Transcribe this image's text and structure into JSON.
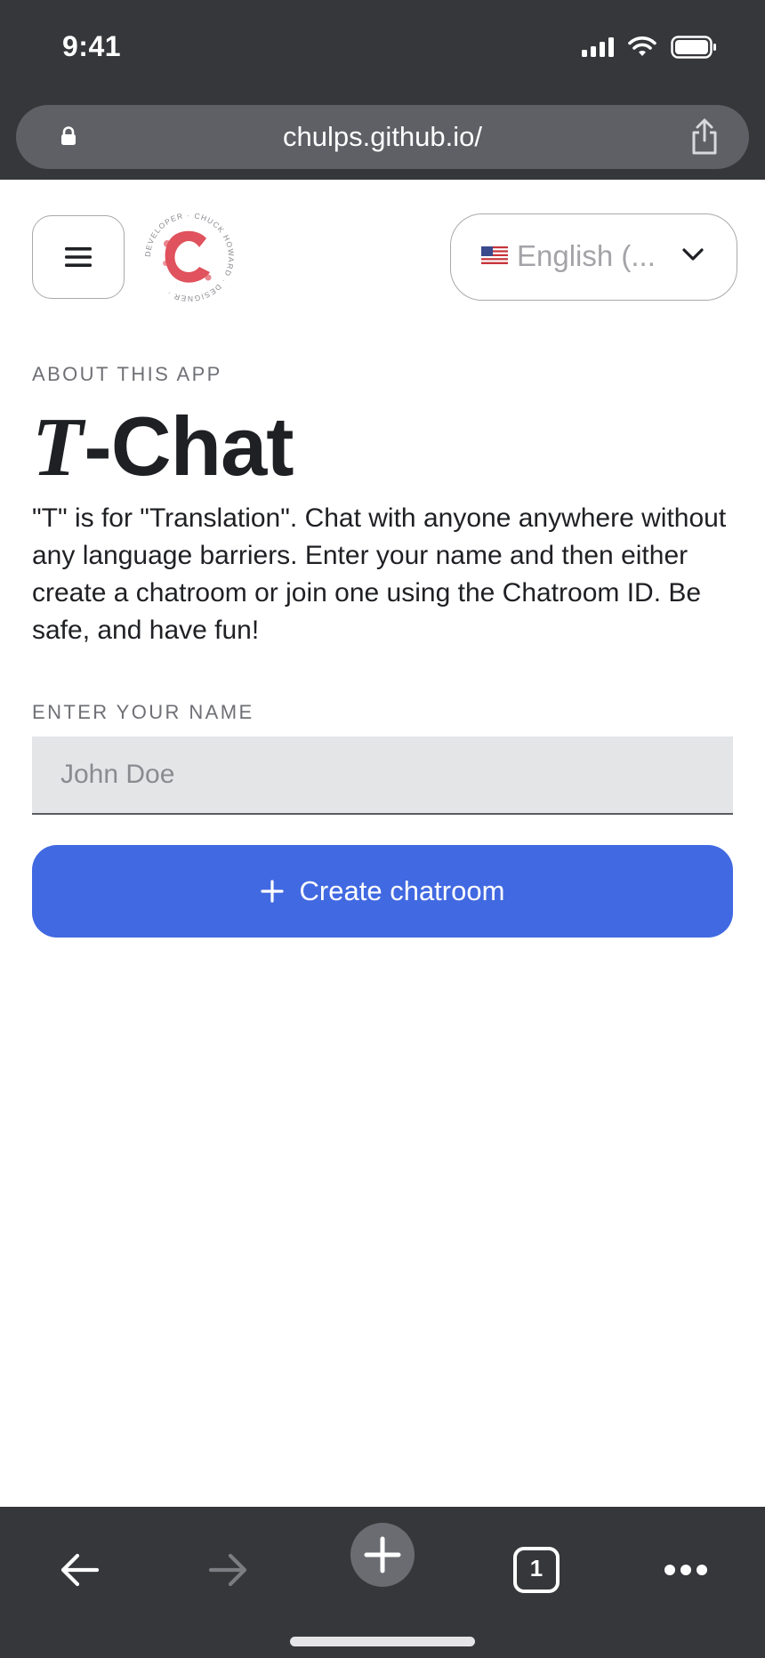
{
  "status_bar": {
    "time": "9:41"
  },
  "browser": {
    "url": "chulps.github.io/"
  },
  "header": {
    "language": {
      "flag": "🇺🇸",
      "selected": "English (..."
    }
  },
  "content": {
    "eyebrow": "ABOUT THIS APP",
    "title_t": "T",
    "title_rest": "-Chat",
    "description": "\"T\" is for \"Translation\". Chat with anyone anywhere without any language barriers. Enter your name and then either create a chatroom or join one using the Chatroom ID. Be safe, and have fun!",
    "name_label": "ENTER YOUR NAME",
    "name_placeholder": "John Doe",
    "create_button": "Create chatroom"
  },
  "toolbar": {
    "tab_count": "1"
  },
  "colors": {
    "accent": "#4169e1",
    "chrome": "#36373b",
    "logo": "#e0525d"
  }
}
